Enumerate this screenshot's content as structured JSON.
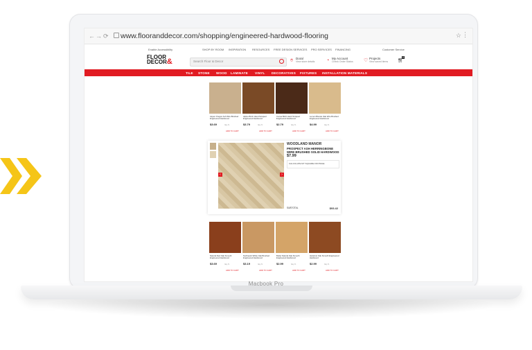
{
  "browser": {
    "url": "www.flooranddecor.com/shopping/engineered-hardwood-flooring",
    "nav": [
      "←",
      "→",
      "⟳"
    ]
  },
  "device_label": "Macbook Pro",
  "utility_bar": {
    "left": "Enable Accessibility",
    "links": [
      "SHOP BY ROOM",
      "INSPIRATION",
      "RESOURCES",
      "FREE DESIGN SERVICES",
      "PRO SERVICES",
      "FINANCING"
    ],
    "right": "Customer Service"
  },
  "header": {
    "logo_top": "FLOOR",
    "logo_amp": "&",
    "logo_bottom": "DECOR",
    "search_placeholder": "Search Floor & Decor",
    "store": {
      "label": "Doral",
      "sub": "View store details"
    },
    "account": {
      "label": "My Account",
      "sub": "Check Order Status"
    },
    "projects": {
      "label": "Projects",
      "sub": "View saved items"
    },
    "cart_count": "0"
  },
  "categories": [
    "TILE",
    "STONE",
    "WOOD",
    "LAMINATE",
    "VINYL",
    "DECORATIVES",
    "FIXTURES",
    "INSTALLATION MATERIALS"
  ],
  "colors": {
    "brand_red": "#e11b22"
  },
  "products_top": [
    {
      "name": "Aspen Oregon Ash Wire Brushed Engineered Hardwood",
      "price": "$3.69",
      "color": "#c9b08e"
    },
    {
      "name": "Alpine Birch Hand Scraped Engineered Hardwood",
      "price": "$3.79",
      "color": "#7a4a26"
    },
    {
      "name": "Cocoa Birch Hand Scraped Engineered Hardwood",
      "price": "$2.79",
      "color": "#4b2a18"
    },
    {
      "name": "Lemon Blonde Oak Wire Brushed Engineered Hardwood",
      "price": "$4.99",
      "color": "#d9bb8c"
    }
  ],
  "products_bottom": [
    {
      "name": "Natural Red Oak Smooth Engineered Hardwood",
      "price": "$3.69",
      "color": "#8a3f1c"
    },
    {
      "name": "Northpoint White Oak Brushed Engineered Hardwood",
      "price": "$3.19",
      "color": "#c99863"
    },
    {
      "name": "Butler Natural Oak Smooth Engineered Hardwood",
      "price": "$2.99",
      "color": "#d4a468"
    },
    {
      "name": "Hazelnut Oak Smooth Engineered Hardwood",
      "price": "$2.99",
      "color": "#8d4a22"
    }
  ],
  "product_labels": {
    "add_to_cart": "ADD TO CART",
    "per_unit": "/sq. ft."
  },
  "feature": {
    "brand": "WOODLAND MANOR",
    "title": "PROSPECT ASH HERRINGBONE WIRE BRUSHED SOLID HARDWOOD",
    "price": "$7.99",
    "calc_label": "CALCULATE MY SQUARE FOOTAGE",
    "total_label": "SUBTOTAL",
    "total": "$93.42"
  }
}
